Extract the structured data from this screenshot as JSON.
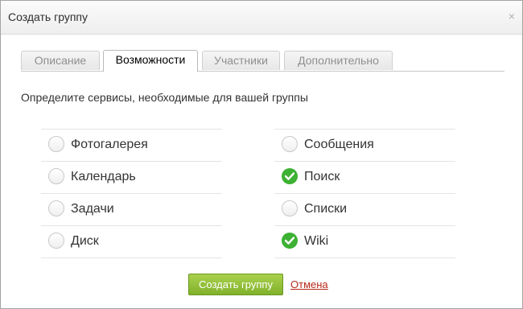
{
  "dialog": {
    "title": "Создать группу",
    "close_label": "×"
  },
  "tabs": [
    {
      "label": "Описание",
      "active": false
    },
    {
      "label": "Возможности",
      "active": true
    },
    {
      "label": "Участники",
      "active": false
    },
    {
      "label": "Дополнительно",
      "active": false
    }
  ],
  "intro": "Определите сервисы, необходимые для вашей группы",
  "services": {
    "left": [
      {
        "label": "Фотогалерея",
        "checked": false
      },
      {
        "label": "Календарь",
        "checked": false
      },
      {
        "label": "Задачи",
        "checked": false
      },
      {
        "label": "Диск",
        "checked": false
      }
    ],
    "right": [
      {
        "label": "Сообщения",
        "checked": false
      },
      {
        "label": "Поиск",
        "checked": true
      },
      {
        "label": "Списки",
        "checked": false
      },
      {
        "label": "Wiki",
        "checked": true
      }
    ]
  },
  "actions": {
    "submit_label": "Создать группу",
    "cancel_label": "Отмена"
  },
  "colors": {
    "accent_green": "#3db133",
    "button_green": "#8cbf34",
    "cancel_red": "#b52a1c"
  }
}
